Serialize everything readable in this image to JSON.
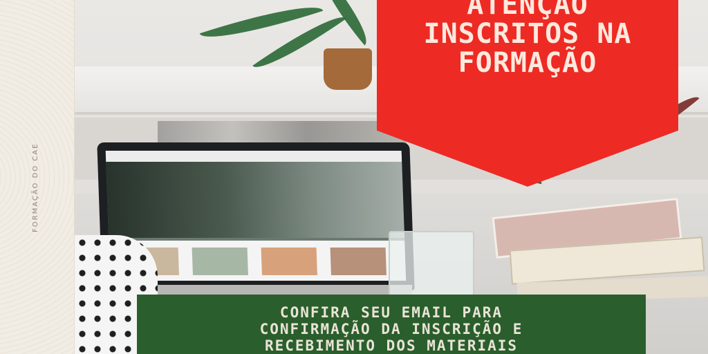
{
  "side_caption": "FORMAÇÃO DO CAE",
  "banner": {
    "lines": [
      "ATENÇÃO",
      "INSCRITOS NA",
      "FORMAÇÃO"
    ]
  },
  "notice": {
    "lines": [
      "CONFIRA SEU EMAIL PARA",
      "CONFIRMAÇÃO DA INSCRIÇÃO E",
      "RECEBIMENTO DOS MATERIAIS"
    ]
  },
  "colors": {
    "banner_red": "#ee2a24",
    "notice_green": "#2a5e2c",
    "text_cream": "#fde9dd"
  }
}
